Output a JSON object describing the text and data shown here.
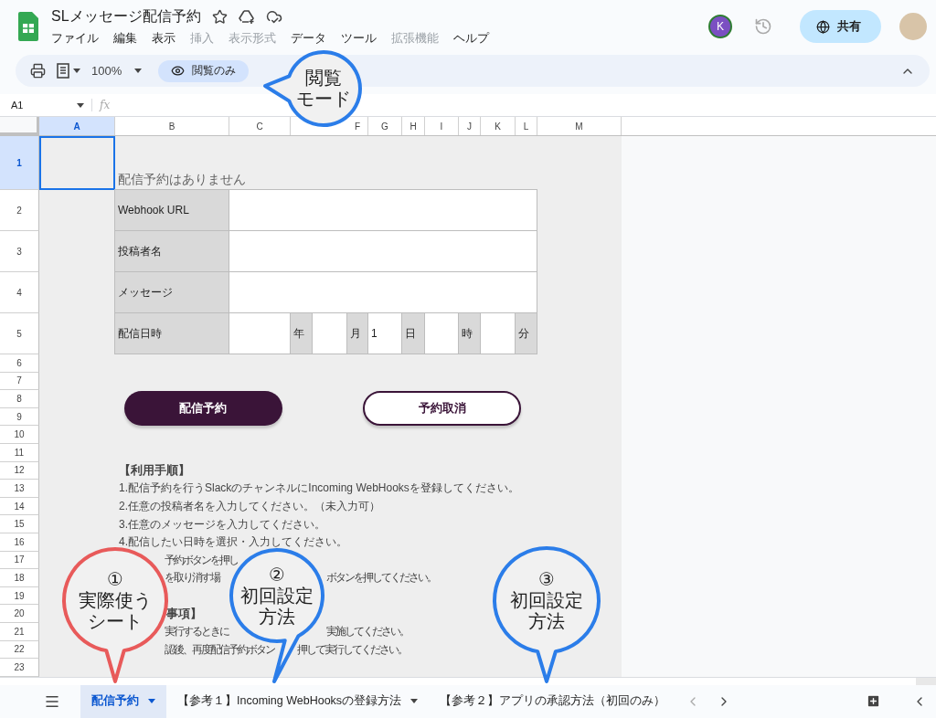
{
  "document": {
    "title": "SLメッセージ配信予約"
  },
  "menu": [
    {
      "label": "ファイル",
      "disabled": false
    },
    {
      "label": "編集",
      "disabled": false
    },
    {
      "label": "表示",
      "disabled": false
    },
    {
      "label": "挿入",
      "disabled": true
    },
    {
      "label": "表示形式",
      "disabled": true
    },
    {
      "label": "データ",
      "disabled": false
    },
    {
      "label": "ツール",
      "disabled": false
    },
    {
      "label": "拡張機能",
      "disabled": true
    },
    {
      "label": "ヘルプ",
      "disabled": false
    }
  ],
  "account": {
    "initial": "K"
  },
  "share_button": {
    "label": "共有"
  },
  "toolbar": {
    "zoom": "100%",
    "mode_chip": "閲覧のみ"
  },
  "formula_bar": {
    "cell_ref": "A1",
    "fx": "fx"
  },
  "sheet": {
    "columns": [
      {
        "label": "A",
        "selected": true
      },
      {
        "label": "B",
        "selected": false
      },
      {
        "label": "C",
        "selected": false
      },
      {
        "label": "F",
        "selected": false
      },
      {
        "label": "G",
        "selected": false
      },
      {
        "label": "H",
        "selected": false
      },
      {
        "label": "I",
        "selected": false
      },
      {
        "label": "J",
        "selected": false
      },
      {
        "label": "K",
        "selected": false
      },
      {
        "label": "L",
        "selected": false
      },
      {
        "label": "M",
        "selected": false
      }
    ],
    "rows": [
      {
        "label": "1",
        "selected": true
      },
      {
        "label": "2",
        "selected": false
      },
      {
        "label": "3",
        "selected": false
      },
      {
        "label": "4",
        "selected": false
      },
      {
        "label": "5",
        "selected": false
      },
      {
        "label": "6",
        "selected": false
      },
      {
        "label": "7",
        "selected": false
      },
      {
        "label": "8",
        "selected": false
      },
      {
        "label": "9",
        "selected": false
      },
      {
        "label": "10",
        "selected": false
      },
      {
        "label": "11",
        "selected": false
      },
      {
        "label": "12",
        "selected": false
      },
      {
        "label": "13",
        "selected": false
      },
      {
        "label": "14",
        "selected": false
      },
      {
        "label": "15",
        "selected": false
      },
      {
        "label": "16",
        "selected": false
      },
      {
        "label": "17",
        "selected": false
      },
      {
        "label": "18",
        "selected": false
      },
      {
        "label": "19",
        "selected": false
      },
      {
        "label": "20",
        "selected": false
      },
      {
        "label": "21",
        "selected": false
      },
      {
        "label": "22",
        "selected": false
      },
      {
        "label": "23",
        "selected": false
      }
    ],
    "status_text": "配信予約はありません",
    "form": [
      {
        "label": "Webhook URL"
      },
      {
        "label": "投稿者名"
      },
      {
        "label": "メッセージ"
      }
    ],
    "datetime": {
      "label": "配信日時",
      "cells": [
        {
          "kind": "input"
        },
        {
          "kind": "unit",
          "text": "年"
        },
        {
          "kind": "input"
        },
        {
          "kind": "unit",
          "text": "月"
        },
        {
          "kind": "input",
          "value": "1"
        },
        {
          "kind": "unit",
          "text": "日"
        },
        {
          "kind": "input"
        },
        {
          "kind": "unit",
          "text": "時"
        },
        {
          "kind": "input"
        },
        {
          "kind": "unit",
          "text": "分"
        }
      ]
    },
    "buttons": [
      {
        "label": "配信予約",
        "kind": "primary"
      },
      {
        "label": "予約取消",
        "kind": "secondary"
      }
    ],
    "instructions": [
      {
        "kind": "heading",
        "segments": [
          "【利用手順】"
        ]
      },
      {
        "kind": "text",
        "segments": [
          "1.配信予約を行うSlackのチャンネルにIncoming WebHooksを登録してください。"
        ]
      },
      {
        "kind": "text",
        "segments": [
          "2.任意の投稿者名を入力してください。（未入力可）"
        ]
      },
      {
        "kind": "text",
        "segments": [
          "3.任意のメッセージを入力してください。"
        ]
      },
      {
        "kind": "text",
        "segments": [
          "4.配信したい日時を選択・入力してください。"
        ]
      },
      {
        "kind": "text",
        "segments": [
          "予約ボタンを押し"
        ]
      },
      {
        "kind": "text",
        "segments": [
          "を取り消す場",
          "ボタンを押してください。"
        ]
      },
      {
        "kind": "heading",
        "segments": [
          "事項】"
        ]
      },
      {
        "kind": "text",
        "segments": [
          "実行するときに",
          "実施してください。"
        ]
      },
      {
        "kind": "text",
        "segments": [
          "認後、再度配信予約ボタン",
          "押して実行してください。"
        ]
      }
    ]
  },
  "sheet_tabs": [
    {
      "label": "配信予約",
      "selected": true,
      "caret": true
    },
    {
      "label": "【参考１】Incoming WebHooksの登録方法",
      "selected": false,
      "caret": true
    },
    {
      "label": "【参考２】アプリの承認方法（初回のみ）",
      "selected": false,
      "caret": false
    }
  ],
  "callouts": [
    {
      "lines": [
        "閲覧",
        "モード"
      ],
      "color": "#2b7de9"
    },
    {
      "lines": [
        "①",
        "実際使う",
        "シート"
      ],
      "color": "#e85a5a"
    },
    {
      "lines": [
        "②",
        "初回設定",
        "方法"
      ],
      "color": "#2b7de9"
    },
    {
      "lines": [
        "③",
        "初回設定",
        "方法"
      ],
      "color": "#2b7de9"
    }
  ]
}
